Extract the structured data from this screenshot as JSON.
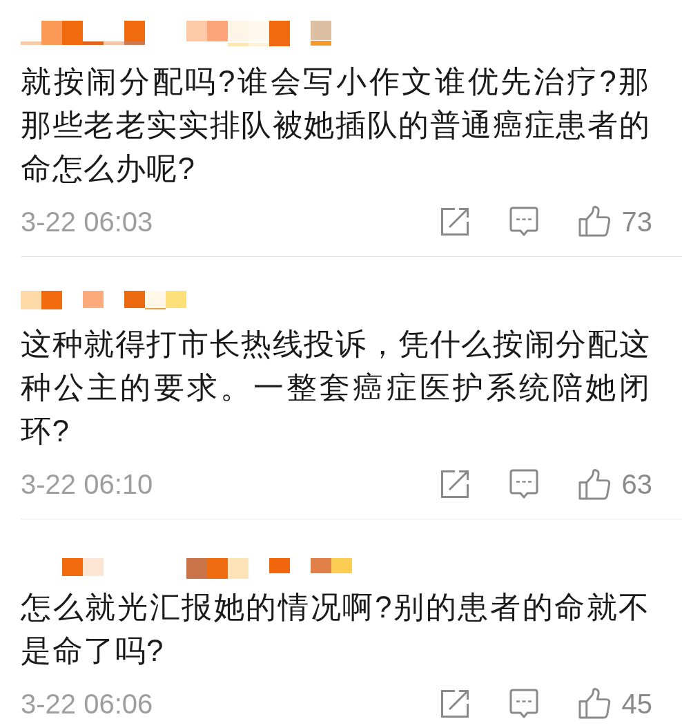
{
  "comments": [
    {
      "name_redacted": true,
      "text": "就按闹分配吗?谁会写小作文谁优先治疗?那那些老老实实排队被她插队的普通癌症患者的命怎么办呢?",
      "time": "3-22 06:03",
      "likes": "73"
    },
    {
      "name_redacted": true,
      "text": "这种就得打市长热线投诉，凭什么按闹分配这种公主的要求。一整套癌症医护系统陪她闭环?",
      "time": "3-22 06:10",
      "likes": "63"
    },
    {
      "name_redacted": true,
      "text": "怎么就光汇报她的情况啊?别的患者的命就不是命了吗?",
      "time": "3-22 06:06",
      "likes": "45"
    }
  ]
}
